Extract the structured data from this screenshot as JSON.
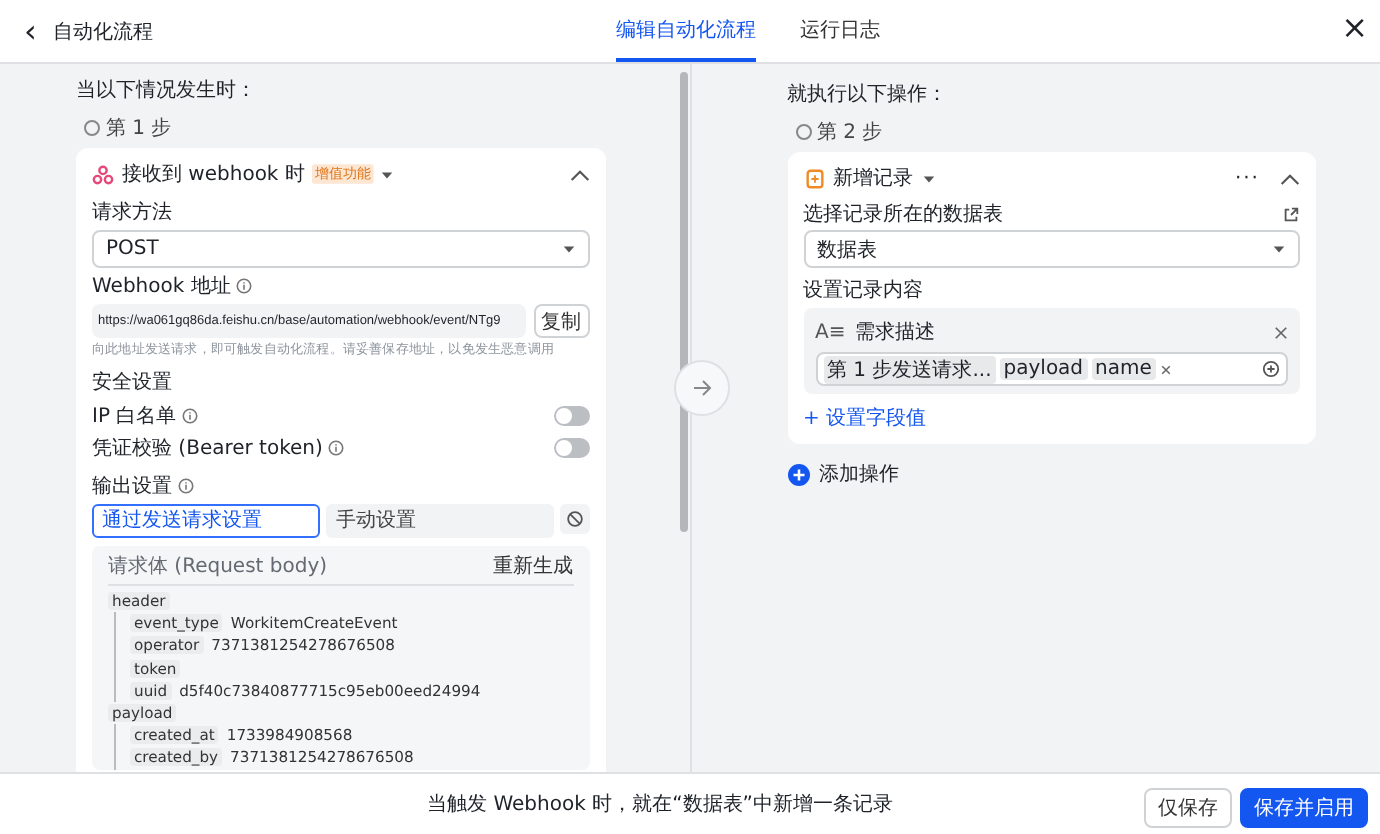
{
  "header": {
    "back": "‹",
    "title": "自动化流程",
    "close": "×"
  },
  "tabs": [
    {
      "label": "编辑自动化流程",
      "selected": true
    },
    {
      "label": "运行日志",
      "selected": false
    }
  ],
  "trigger": {
    "heading": "当以下情况发生时：",
    "step": "第 1 步",
    "card_title": "接收到 webhook 时",
    "badge": "增值功能",
    "method_label": "请求方法",
    "method_value": "POST",
    "url_label": "Webhook 地址",
    "url_value": "https://wa061gq86da.feishu.cn/base/automation/webhook/event/NTg9",
    "copy": "复制",
    "url_hint": "向此地址发送请求，即可触发自动化流程。请妥善保存地址，以免发生恶意调用",
    "security_label": "安全设置",
    "toggles": [
      {
        "label": "IP 白名单",
        "on": false
      },
      {
        "label": "凭证校验 (Bearer token)",
        "on": false
      }
    ],
    "output_label": "输出设置",
    "output_tabs": [
      {
        "label": "通过发送请求设置",
        "selected": true
      },
      {
        "label": "手动设置",
        "selected": false
      }
    ],
    "body_title": "请求体 (Request body)",
    "regenerate": "重新生成",
    "tree": [
      {
        "key": "header",
        "children": [
          {
            "key": "event_type",
            "value": "WorkitemCreateEvent"
          },
          {
            "key": "operator",
            "value": "7371381254278676508"
          },
          {
            "key": "token"
          },
          {
            "key": "uuid",
            "value": "d5f40c73840877715c95eb00eed24994"
          }
        ]
      },
      {
        "key": "payload",
        "children": [
          {
            "key": "created_at",
            "value": "1733984908568"
          },
          {
            "key": "created_by",
            "value": "7371381254278676508"
          }
        ]
      }
    ]
  },
  "action": {
    "heading": "就执行以下操作：",
    "step": "第 2 步",
    "card_title": "新增记录",
    "more": "···",
    "table_label": "选择记录所在的数据表",
    "table_value": "数据表",
    "content_label": "设置记录内容",
    "field_name": "需求描述",
    "field_type": "A≡",
    "tokens": [
      {
        "text": "第 1 步发送请求..."
      },
      {
        "text": "payload"
      },
      {
        "text": "name",
        "removable": true
      }
    ],
    "set_field": "+ 设置字段值",
    "add_action": "添加操作"
  },
  "footer": {
    "summary": "当触发 Webhook 时，就在“数据表”中新增一条记录",
    "buttons": [
      {
        "label": "仅保存",
        "primary": false
      },
      {
        "label": "保存并启用",
        "primary": true
      }
    ]
  }
}
